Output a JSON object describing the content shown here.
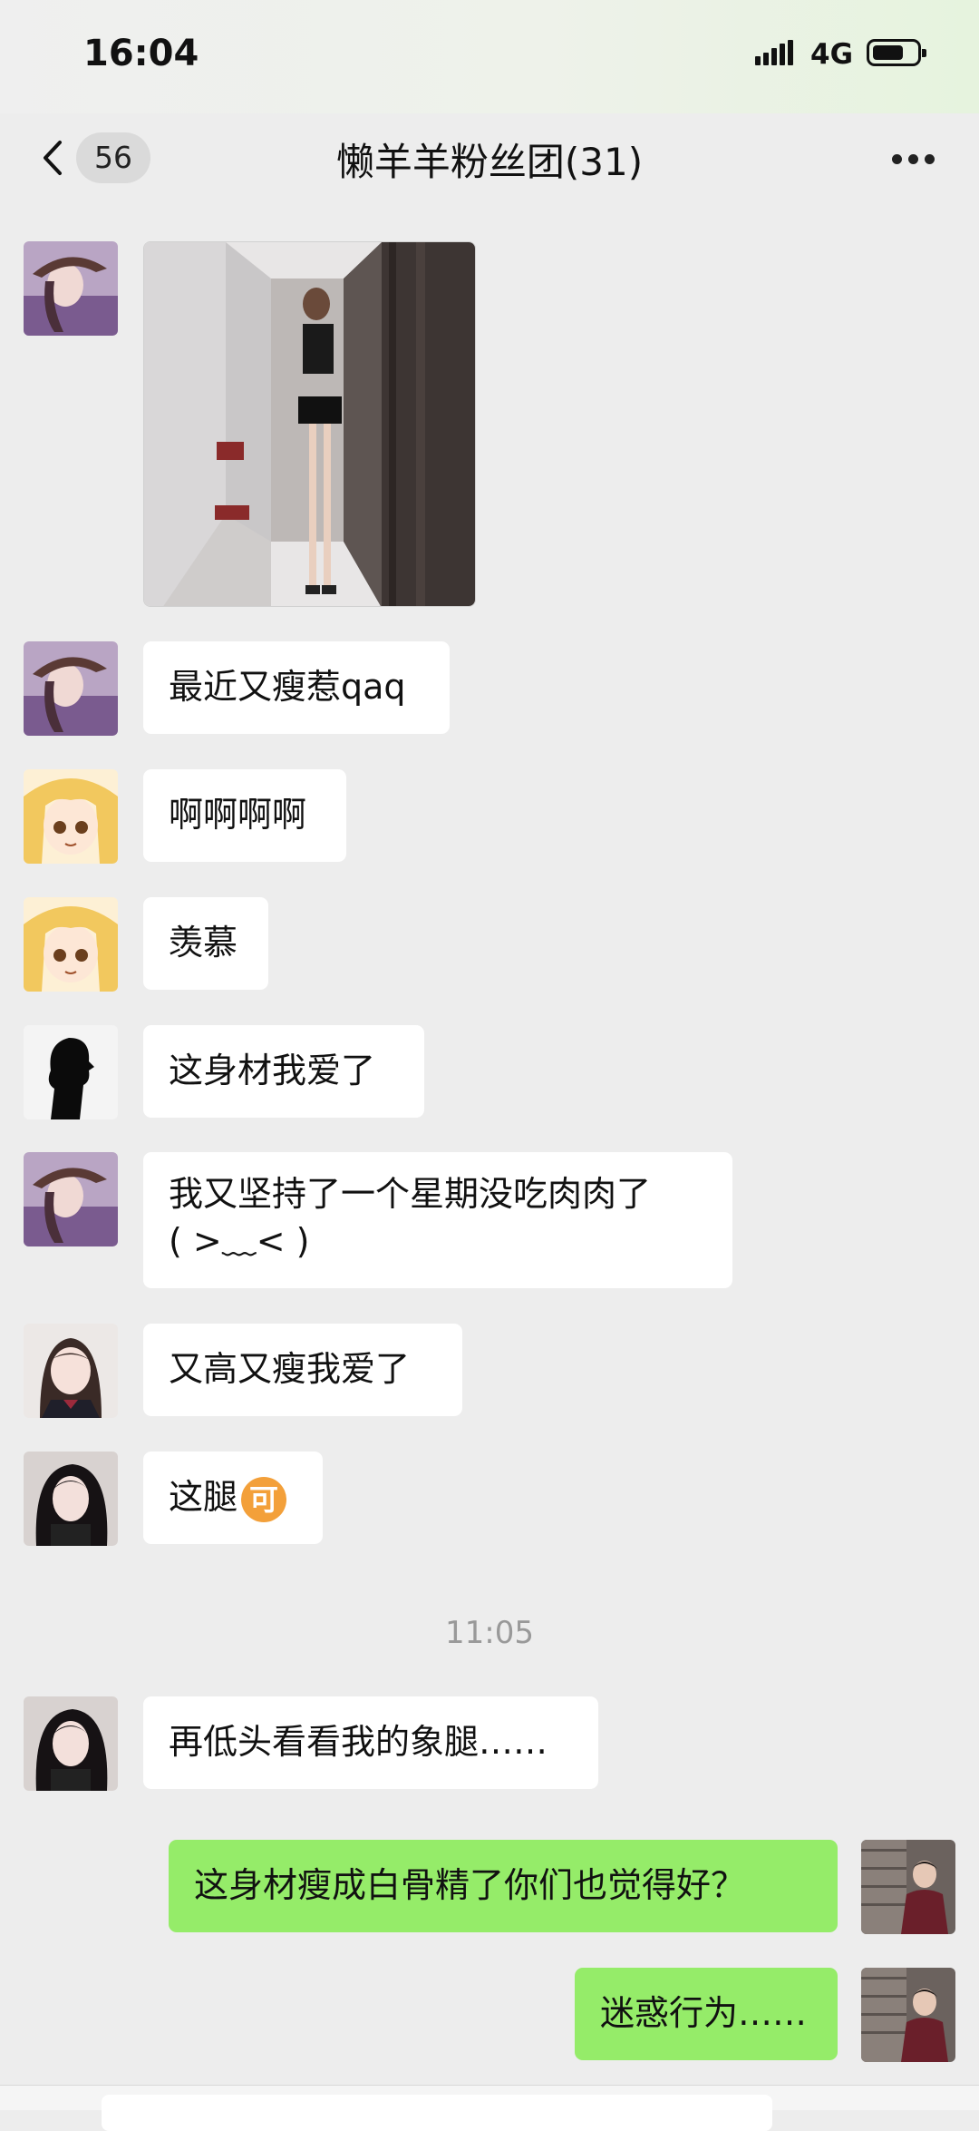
{
  "status_bar": {
    "time": "16:04",
    "network": "4G"
  },
  "header": {
    "back_count": "56",
    "title": "懒羊羊粉丝团(31)"
  },
  "messages": [
    {
      "avatar": "avatar-girl-hat"
    },
    {
      "text": "最近又瘦惹qaq",
      "avatar": "avatar-girl-hat"
    },
    {
      "text": "啊啊啊啊",
      "avatar": "avatar-anime-blonde"
    },
    {
      "text": "羡慕",
      "avatar": "avatar-anime-blonde"
    },
    {
      "text": "这身材我爱了",
      "avatar": "avatar-silhouette"
    },
    {
      "line1": "我又坚持了一个星期没吃肉肉了",
      "line2": "( >﹏< )",
      "avatar": "avatar-girl-hat"
    },
    {
      "text": "又高又瘦我爱了",
      "avatar": "avatar-girl-uniform"
    },
    {
      "text": "这腿",
      "emoji": "可",
      "avatar": "avatar-girl-dark"
    },
    {
      "text": "再低头看看我的象腿……",
      "avatar": "avatar-girl-dark"
    },
    {
      "text": "这身材瘦成白骨精了你们也觉得好？",
      "avatar": "avatar-self"
    },
    {
      "text": "迷惑行为……",
      "avatar": "avatar-self"
    }
  ],
  "time_divider": "11:05",
  "colors": {
    "background": "#ededed",
    "bubble_in": "#ffffff",
    "bubble_out": "#95ec69"
  }
}
